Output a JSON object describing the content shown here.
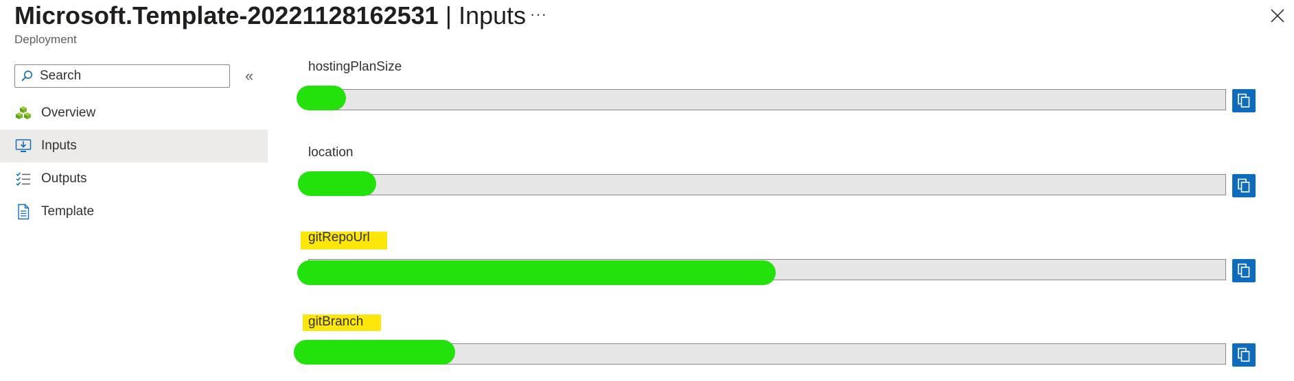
{
  "header": {
    "title": "Microsoft.Template-20221128162531",
    "separator": "|",
    "section": "Inputs",
    "subtitle": "Deployment",
    "more_label": "···"
  },
  "sidebar": {
    "search_placeholder": "Search",
    "collapse_label": "«",
    "items": [
      {
        "label": "Overview",
        "icon": "overview-cubes-icon",
        "active": false
      },
      {
        "label": "Inputs",
        "icon": "inputs-download-icon",
        "active": true
      },
      {
        "label": "Outputs",
        "icon": "outputs-checklist-icon",
        "active": false
      },
      {
        "label": "Template",
        "icon": "template-document-icon",
        "active": false
      }
    ]
  },
  "fields": [
    {
      "label": "hostingPlanSize",
      "value": "",
      "highlighted": false
    },
    {
      "label": "location",
      "value": "",
      "highlighted": false
    },
    {
      "label": "gitRepoUrl",
      "value": "",
      "highlighted": true
    },
    {
      "label": "gitBranch",
      "value": "",
      "highlighted": true
    }
  ],
  "colors": {
    "accent": "#0f6cbd",
    "highlight": "#fde70b",
    "redaction": "#23e10a",
    "field_background": "#e6e6e6"
  }
}
